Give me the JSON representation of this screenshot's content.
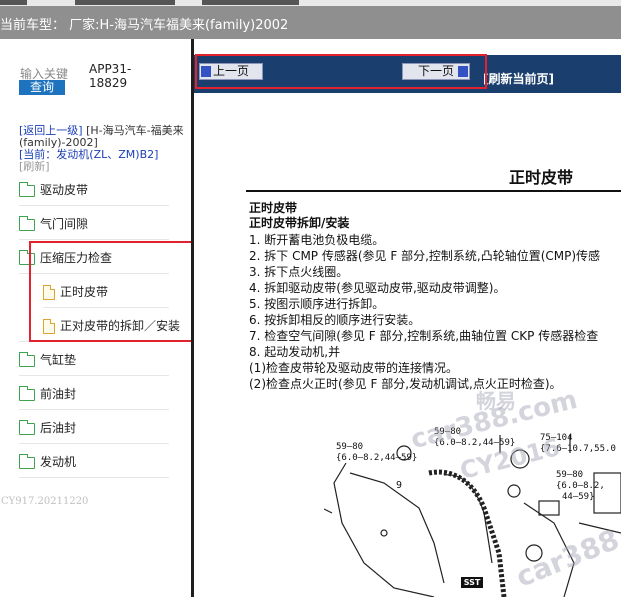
{
  "title_bar": {
    "text": "当前车型：  厂家:H-海马汽车福美来(family)2002"
  },
  "sidebar": {
    "search_label": "输入关键",
    "search_button": "查询",
    "app_code": "APP31-18829",
    "breadcrumb": {
      "back": "[返回上一级]",
      "path": "[H-海马汽车-福美来(family)-2002]",
      "current_prefix": "[当前：",
      "current_value": "发动机(ZL、ZM)B2]",
      "refresh": "[刷新]"
    },
    "tree": [
      {
        "label": "驱动皮带",
        "icon": "folder-icon"
      },
      {
        "label": "气门间隙",
        "icon": "folder-icon"
      },
      {
        "label": "压缩压力检查",
        "icon": "folder-open-icon"
      },
      {
        "label": "正时皮带",
        "icon": "document-icon"
      },
      {
        "label": "正对皮带的拆卸／安装",
        "icon": "document-icon"
      },
      {
        "label": "气缸垫",
        "icon": "folder-icon"
      },
      {
        "label": "前油封",
        "icon": "folder-icon"
      },
      {
        "label": "后油封",
        "icon": "folder-icon"
      },
      {
        "label": "发动机",
        "icon": "folder-icon"
      }
    ],
    "footer": "CY917.20211220"
  },
  "toolbar": {
    "prev_label": "上一页",
    "next_label": "下一页",
    "refresh_label": "[刷新当前页]"
  },
  "document": {
    "title": "正时皮带",
    "section_heading": "正时皮带",
    "subheading": "正时皮带拆卸/安装",
    "steps": [
      "1. 断开蓄电池负极电缆。",
      "2. 拆下 CMP 传感器(参见 F 部分,控制系统,凸轮轴位置(CMP)传感",
      "3. 拆下点火线圈。",
      "4. 拆卸驱动皮带(参见驱动皮带,驱动皮带调整)。",
      "5. 按图示顺序进行拆卸。",
      "6. 按拆卸相反的顺序进行安装。",
      "7. 检查空气间隙(参见 F 部分,控制系统,曲轴位置 CKP 传感器检查",
      "8. 起动发动机,并",
      "   (1)检查皮带轮及驱动皮带的连接情况。",
      "   (2)检查点火正时(参见 F 部分,发动机调试,点火正时检查)。"
    ],
    "figure_labels": [
      "59—80",
      "{6.0—8.2,44—59}",
      "59—80",
      "{6.0—8.2,44—59}",
      "75—104",
      "{7.6—10.7,55.0",
      "59—80",
      "{6.0—8.2,",
      "44—59}",
      "9",
      "SST"
    ],
    "watermarks": [
      "畅易",
      "car388.com",
      "CY2016",
      "car388.co"
    ]
  },
  "colors": {
    "title_bar_bg": "#8f8f8f",
    "nav_bar_bg": "#1a3f6e",
    "highlight_red": "#e2222c",
    "link_blue": "#1a3fb5",
    "query_button_bg": "#1e73be"
  }
}
